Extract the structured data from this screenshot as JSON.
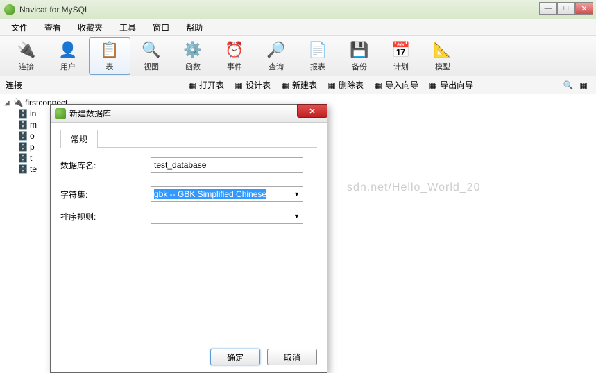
{
  "title": "Navicat for MySQL",
  "menu": [
    "文件",
    "查看",
    "收藏夹",
    "工具",
    "窗口",
    "帮助"
  ],
  "toolbar": [
    {
      "label": "连接",
      "icon": "🔌"
    },
    {
      "label": "用户",
      "icon": "👤"
    },
    {
      "label": "表",
      "icon": "📋",
      "active": true
    },
    {
      "label": "视图",
      "icon": "🔍"
    },
    {
      "label": "函数",
      "icon": "⚙️"
    },
    {
      "label": "事件",
      "icon": "⏰"
    },
    {
      "label": "查询",
      "icon": "🔎"
    },
    {
      "label": "报表",
      "icon": "📄"
    },
    {
      "label": "备份",
      "icon": "💾"
    },
    {
      "label": "计划",
      "icon": "📅"
    },
    {
      "label": "模型",
      "icon": "📐"
    }
  ],
  "subbar_left": "连接",
  "subbar_actions": [
    {
      "label": "打开表"
    },
    {
      "label": "设计表"
    },
    {
      "label": "新建表"
    },
    {
      "label": "删除表"
    },
    {
      "label": "导入向导"
    },
    {
      "label": "导出向导"
    }
  ],
  "tree": {
    "root": "firstconnect",
    "children": [
      "in",
      "m",
      "o",
      "p",
      "t",
      "te"
    ]
  },
  "watermark": "sdn.net/Hello_World_20",
  "dialog": {
    "title": "新建数据库",
    "tab": "常规",
    "fields": {
      "name_label": "数据库名:",
      "name_value": "test_database",
      "charset_label": "字符集:",
      "charset_value": "gbk -- GBK Simplified Chinese",
      "collation_label": "排序规则:",
      "collation_value": ""
    },
    "ok": "确定",
    "cancel": "取消"
  }
}
